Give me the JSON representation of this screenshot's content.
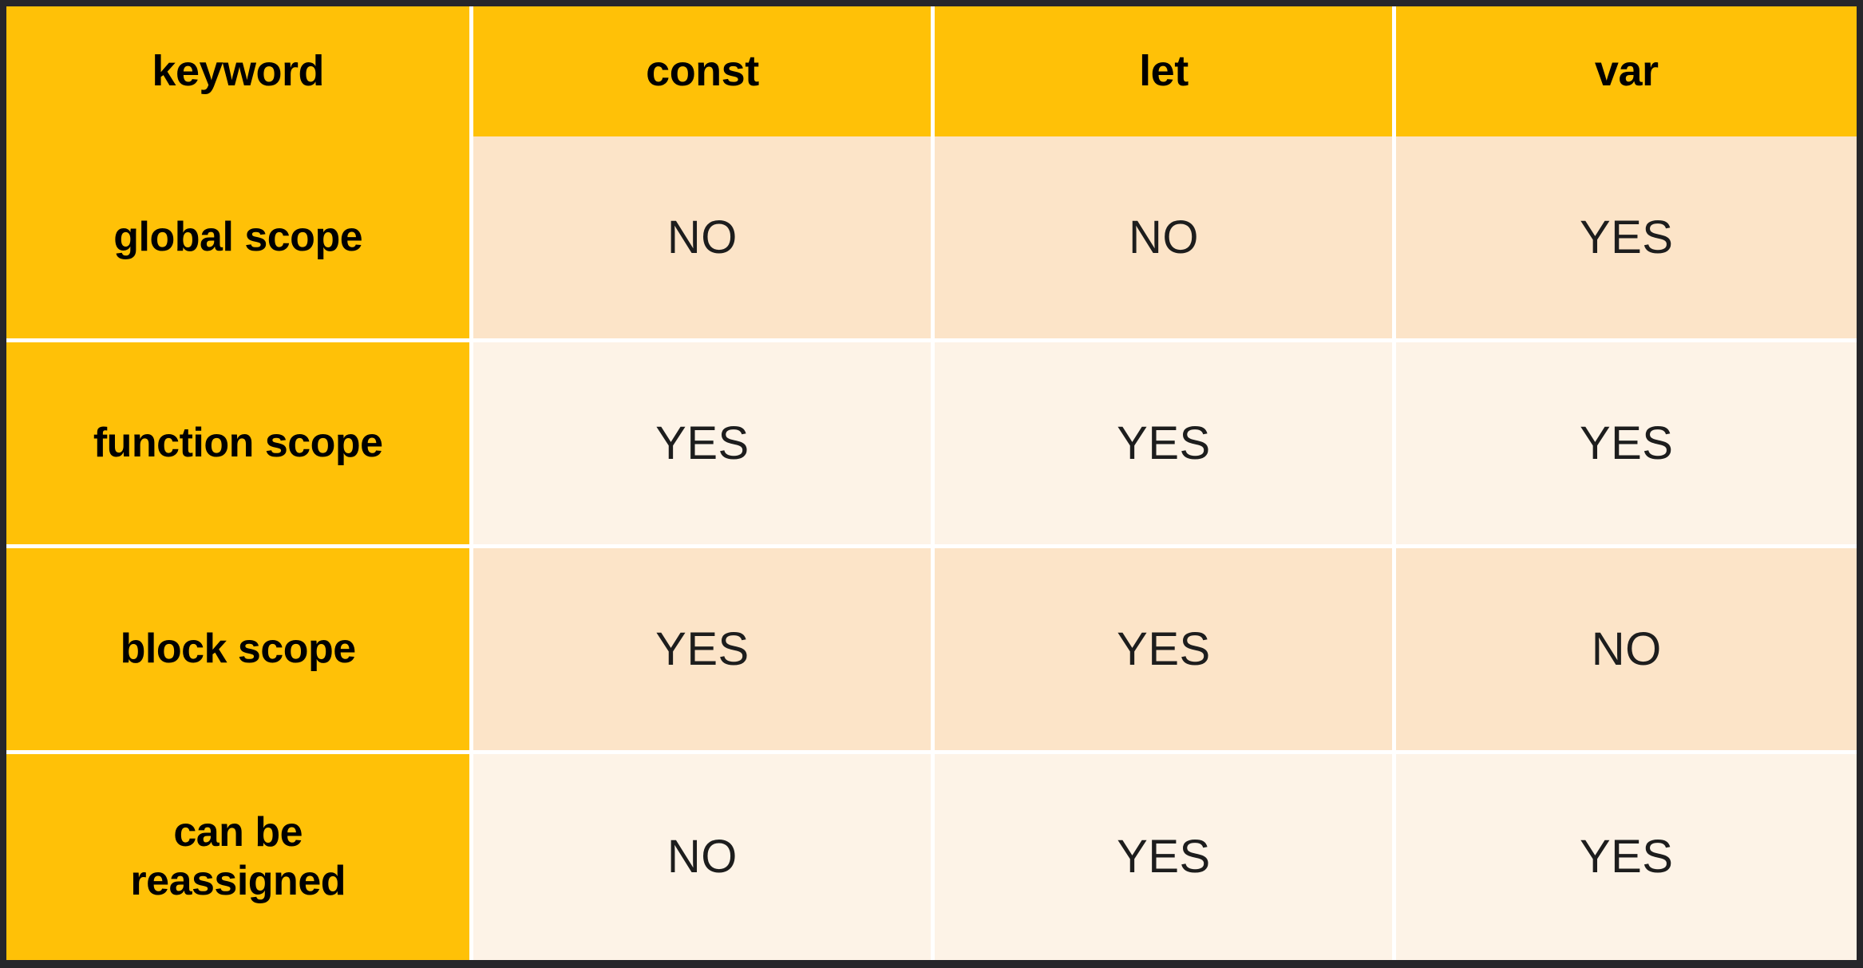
{
  "table": {
    "columns": [
      "keyword",
      "const",
      "let",
      "var"
    ],
    "rows": [
      {
        "label": "global scope",
        "values": [
          "NO",
          "NO",
          "YES"
        ]
      },
      {
        "label": "function scope",
        "values": [
          "YES",
          "YES",
          "YES"
        ]
      },
      {
        "label": "block scope",
        "values": [
          "YES",
          "YES",
          "NO"
        ]
      },
      {
        "label": "can be\nreassigned",
        "values": [
          "NO",
          "YES",
          "YES"
        ]
      }
    ]
  },
  "colors": {
    "page_background": "#26262A",
    "header_background": "#FFC107",
    "row_label_background": "#FFC107",
    "row_shade_dark": "#FCE4C8",
    "row_shade_light": "#FDF3E7",
    "gridline": "#FFFFFF",
    "text": "#000000"
  }
}
